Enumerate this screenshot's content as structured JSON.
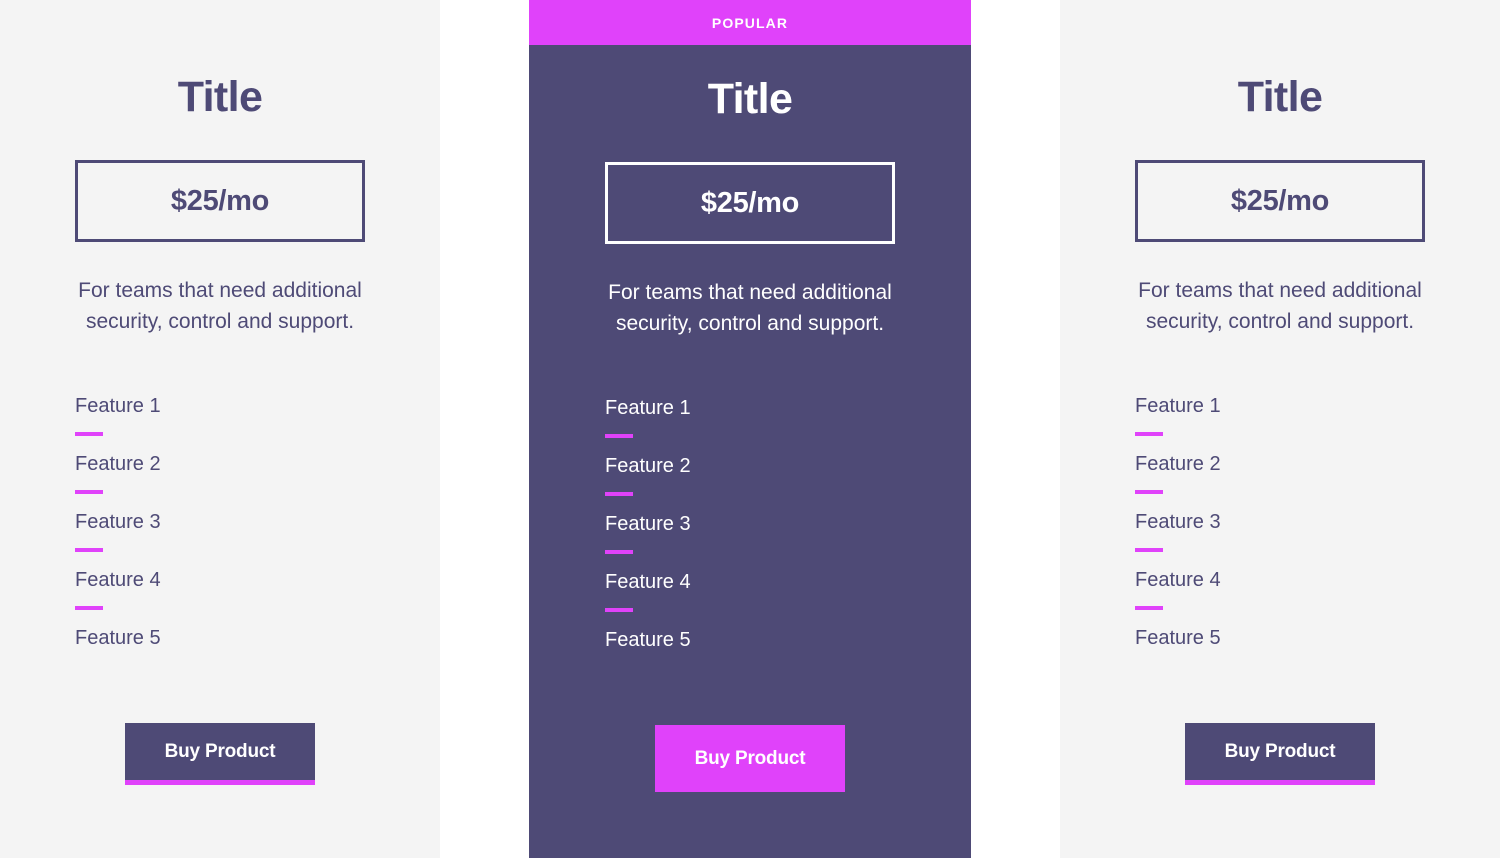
{
  "theme": {
    "accent_magenta": "#e042fa",
    "deep_purple": "#4e4a76",
    "card_bg_light": "#f4f4f4",
    "page_bg": "#ffffff",
    "text_on_dark": "#ffffff"
  },
  "cards": [
    {
      "variant": "standard",
      "badge": null,
      "title": "Title",
      "price": "$25/mo",
      "description": "For teams that need additional security, control and support.",
      "features": [
        "Feature 1",
        "Feature 2",
        "Feature 3",
        "Feature 4",
        "Feature 5"
      ],
      "cta_label": "Buy Product"
    },
    {
      "variant": "featured",
      "badge": "POPULAR",
      "title": "Title",
      "price": "$25/mo",
      "description": "For teams that need additional security, control and support.",
      "features": [
        "Feature 1",
        "Feature 2",
        "Feature 3",
        "Feature 4",
        "Feature 5"
      ],
      "cta_label": "Buy Product"
    },
    {
      "variant": "standard",
      "badge": null,
      "title": "Title",
      "price": "$25/mo",
      "description": "For teams that need additional security, control and support.",
      "features": [
        "Feature 1",
        "Feature 2",
        "Feature 3",
        "Feature 4",
        "Feature 5"
      ],
      "cta_label": "Buy Product"
    }
  ]
}
